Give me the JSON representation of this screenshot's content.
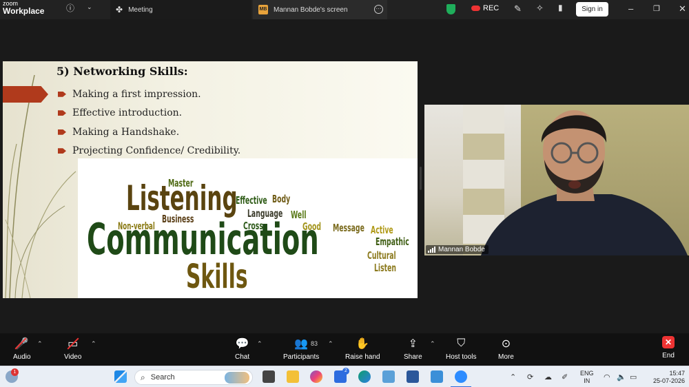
{
  "titlebar": {
    "brand_top": "zoom",
    "brand_bottom": "Workplace",
    "meeting_tab": "Meeting",
    "screen_badge": "MB",
    "screen_tab": "Mannan Bobde's screen",
    "rec_label": "REC",
    "signin_label": "Sign in"
  },
  "slide": {
    "heading": "5) Networking Skills:",
    "bullets": [
      "Making a first impression.",
      "Effective introduction.",
      "Making a Handshake.",
      "Projecting Confidence/ Credibility."
    ],
    "words": {
      "listening": "Listening",
      "master": "Master",
      "effective": "Effective",
      "body": "Body",
      "language": "Language",
      "well": "Well",
      "business": "Business",
      "nonverbal": "Non-verbal",
      "cross": "Cross",
      "good": "Good",
      "message": "Message",
      "active": "Active",
      "empathic": "Empathic",
      "communication": "Communication",
      "cultural": "Cultural",
      "listen": "Listen",
      "skills": "Skills"
    },
    "accent_color": "#b03a1c"
  },
  "video": {
    "participant_name": "Mannan Bobde"
  },
  "toolbar": {
    "audio": "Audio",
    "video": "Video",
    "chat": "Chat",
    "participants": "Participants",
    "participants_count": "83",
    "raise_hand": "Raise hand",
    "share": "Share",
    "host_tools": "Host tools",
    "more": "More",
    "end": "End",
    "end_color": "#e33333"
  },
  "taskbar": {
    "search_placeholder": "Search",
    "notification_count": "1",
    "store_badge": "2",
    "lang_top": "ENG",
    "lang_bottom": "IN",
    "time": "15:47",
    "date": "25-07-2026"
  }
}
